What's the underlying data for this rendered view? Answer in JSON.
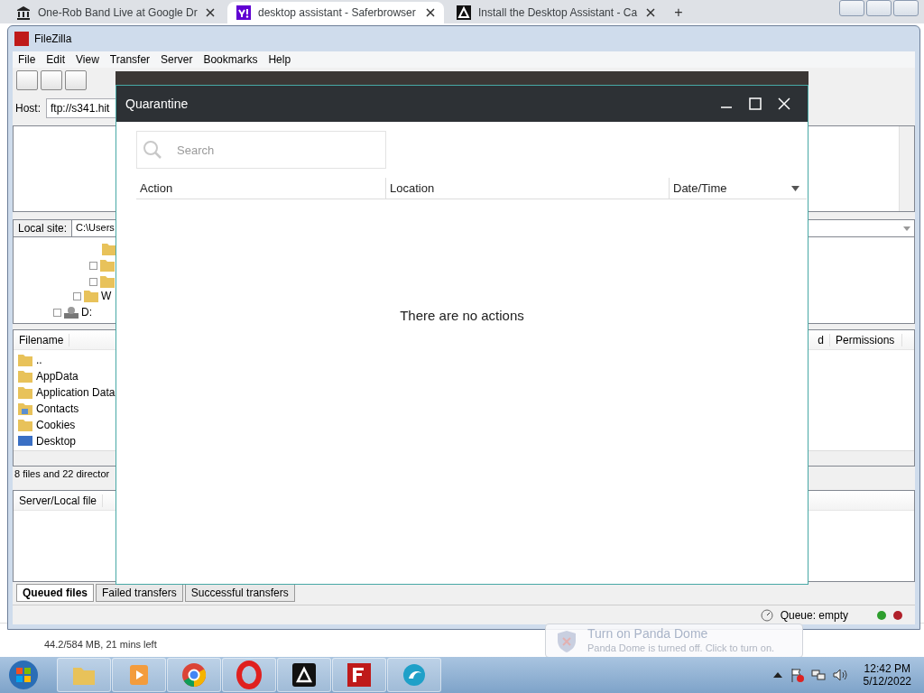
{
  "browser": {
    "tabs": [
      {
        "title": "One-Rob Band Live at Google Dr",
        "selected": false
      },
      {
        "title": "desktop assistant - Saferbrowser",
        "selected": true
      },
      {
        "title": "Install the Desktop Assistant - Ca",
        "selected": false
      }
    ],
    "new_tab": "+",
    "download": "44.2/584 MB, 21 mins left"
  },
  "filezilla": {
    "title": "FileZilla",
    "menu": [
      "File",
      "Edit",
      "View",
      "Transfer",
      "Server",
      "Bookmarks",
      "Help"
    ],
    "host_label": "Host:",
    "host_value": "ftp://s341.hit",
    "local_site_label": "Local site:",
    "local_path": "C:\\Users",
    "tree": [
      {
        "label": "W",
        "kind": "folder"
      },
      {
        "label": "D:",
        "kind": "drive"
      }
    ],
    "local_columns": [
      "Filename"
    ],
    "files": [
      {
        "name": "..",
        "kind": "folder"
      },
      {
        "name": "AppData",
        "kind": "folder"
      },
      {
        "name": "Application Data",
        "kind": "folder"
      },
      {
        "name": "Contacts",
        "kind": "contacts"
      },
      {
        "name": "Cookies",
        "kind": "folder"
      },
      {
        "name": "Desktop",
        "kind": "desktop"
      }
    ],
    "local_status": "8 files and 22 director",
    "remote_columns": [
      "d",
      "Permissions"
    ],
    "queue_columns": [
      "Server/Local file"
    ],
    "queue_tabs": [
      {
        "label": "Queued files",
        "selected": true
      },
      {
        "label": "Failed transfers",
        "selected": false
      },
      {
        "label": "Successful transfers",
        "selected": false
      }
    ],
    "status": "Queue: empty",
    "lights": [
      {
        "color": "#2e9e2e"
      },
      {
        "color": "#b0202a"
      }
    ]
  },
  "quarantine": {
    "title": "Quarantine",
    "search": {
      "placeholder": "Search"
    },
    "columns": [
      {
        "label": "Action",
        "sorted": false
      },
      {
        "label": "Location",
        "sorted": false
      },
      {
        "label": "Date/Time",
        "sorted": true
      }
    ],
    "empty_message": "There are no actions"
  },
  "notification": {
    "title": "Turn on Panda Dome",
    "message": "Panda Dome is turned off. Click to turn on."
  },
  "taskbar": {
    "time": "12:42 PM",
    "date": "5/12/2022"
  }
}
